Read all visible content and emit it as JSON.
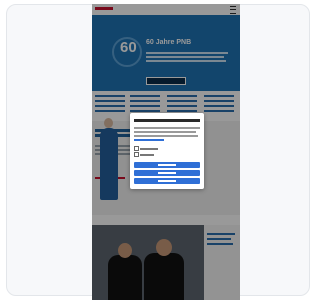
{
  "page": {
    "hero": {
      "badge": "60",
      "title": "60 Jahre PNB"
    },
    "colors": {
      "accent": "#2f6fd6",
      "brand": "#c8102e",
      "hero": "#1f73b5",
      "overlay": "rgba(0,0,0,0.4)"
    },
    "icons": [
      "hamburger-menu-icon"
    ]
  }
}
